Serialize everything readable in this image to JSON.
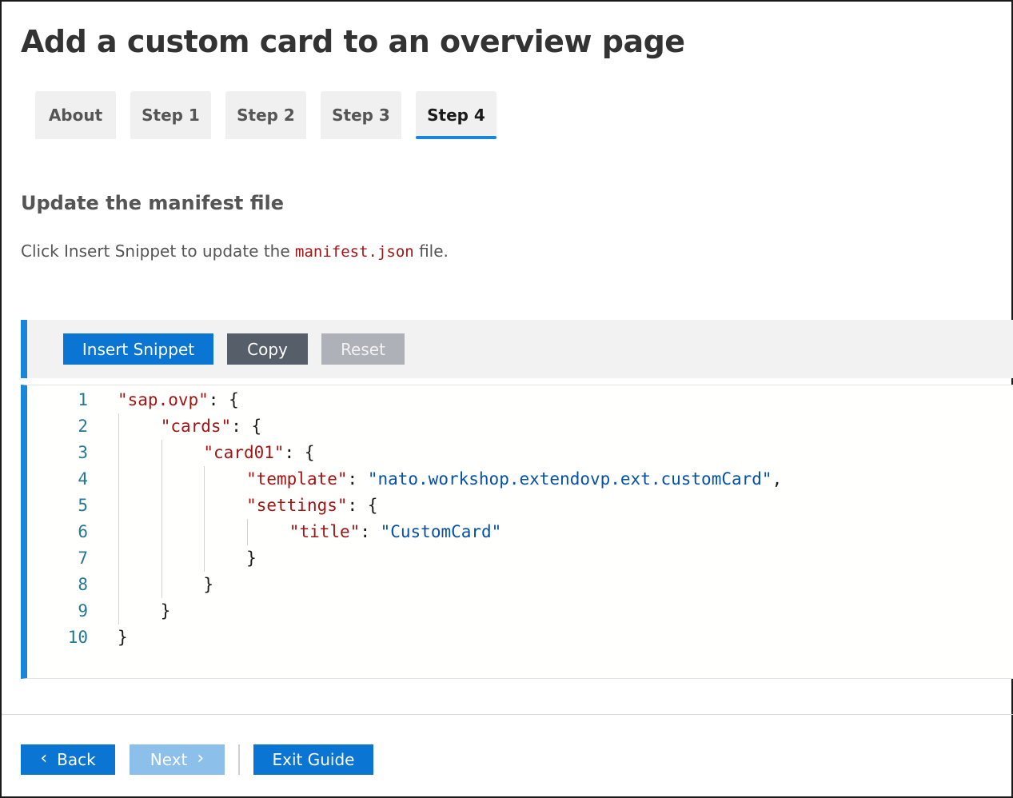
{
  "page": {
    "title": "Add a custom card to an overview page"
  },
  "tabs": [
    {
      "label": "About",
      "active": false
    },
    {
      "label": "Step 1",
      "active": false
    },
    {
      "label": "Step 2",
      "active": false
    },
    {
      "label": "Step 3",
      "active": false
    },
    {
      "label": "Step 4",
      "active": true
    }
  ],
  "section": {
    "title": "Update the manifest file",
    "instruction_before": "Click Insert Snippet to update the ",
    "instruction_code": "manifest.json",
    "instruction_after": " file."
  },
  "toolbar": {
    "insert_label": "Insert Snippet",
    "copy_label": "Copy",
    "reset_label": "Reset"
  },
  "code": {
    "lines": [
      {
        "no": "1",
        "indent": 0,
        "tokens": [
          {
            "t": "key",
            "v": "\"sap.ovp\""
          },
          {
            "t": "plain",
            "v": ": {"
          }
        ]
      },
      {
        "no": "2",
        "indent": 1,
        "tokens": [
          {
            "t": "key",
            "v": "\"cards\""
          },
          {
            "t": "plain",
            "v": ": {"
          }
        ]
      },
      {
        "no": "3",
        "indent": 2,
        "tokens": [
          {
            "t": "key",
            "v": "\"card01\""
          },
          {
            "t": "plain",
            "v": ": {"
          }
        ]
      },
      {
        "no": "4",
        "indent": 3,
        "tokens": [
          {
            "t": "key",
            "v": "\"template\""
          },
          {
            "t": "plain",
            "v": ": "
          },
          {
            "t": "str",
            "v": "\"nato.workshop.extendovp.ext.customCard\""
          },
          {
            "t": "plain",
            "v": ","
          }
        ]
      },
      {
        "no": "5",
        "indent": 3,
        "tokens": [
          {
            "t": "key",
            "v": "\"settings\""
          },
          {
            "t": "plain",
            "v": ": {"
          }
        ]
      },
      {
        "no": "6",
        "indent": 4,
        "tokens": [
          {
            "t": "key",
            "v": "\"title\""
          },
          {
            "t": "plain",
            "v": ": "
          },
          {
            "t": "str",
            "v": "\"CustomCard\""
          }
        ]
      },
      {
        "no": "7",
        "indent": 3,
        "tokens": [
          {
            "t": "plain",
            "v": "}"
          }
        ]
      },
      {
        "no": "8",
        "indent": 2,
        "tokens": [
          {
            "t": "plain",
            "v": "}"
          }
        ]
      },
      {
        "no": "9",
        "indent": 1,
        "tokens": [
          {
            "t": "plain",
            "v": "}"
          }
        ]
      },
      {
        "no": "10",
        "indent": 0,
        "tokens": [
          {
            "t": "plain",
            "v": "}"
          }
        ]
      }
    ]
  },
  "footer": {
    "back_label": "Back",
    "next_label": "Next",
    "exit_label": "Exit Guide",
    "back_icon": "chevron-left-icon",
    "next_icon": "chevron-right-icon"
  },
  "colors": {
    "accent": "#1a86d8",
    "primary_button": "#0a75d2",
    "json_key": "#a31515",
    "json_string": "#0451a5",
    "line_number": "#237893"
  }
}
